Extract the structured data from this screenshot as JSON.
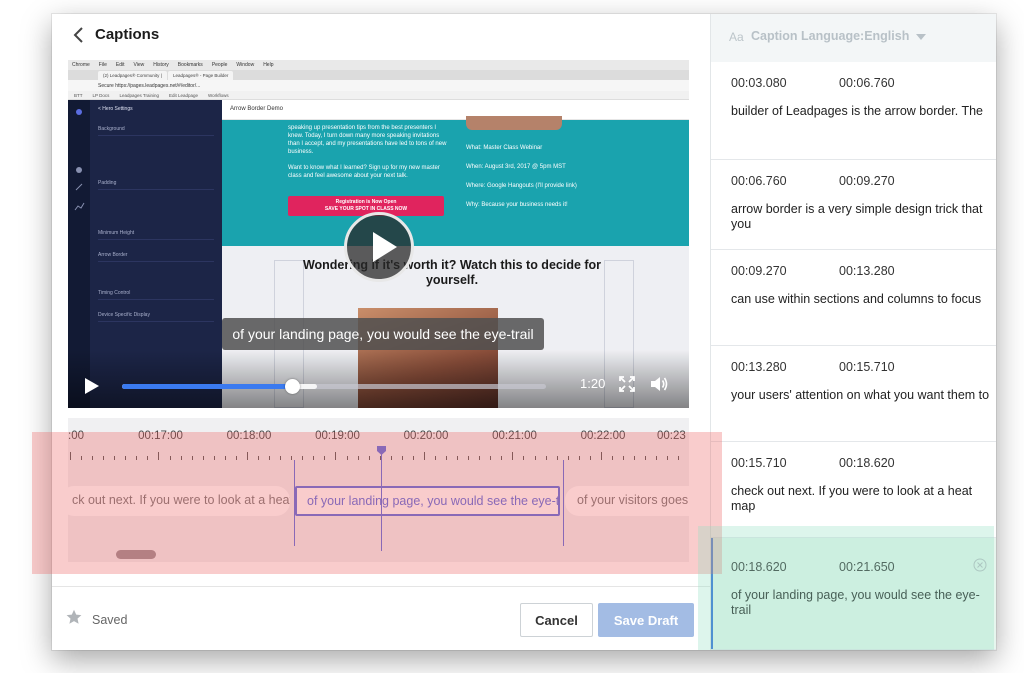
{
  "header": {
    "title": "Captions"
  },
  "video": {
    "browser_menu": [
      "Chrome",
      "File",
      "Edit",
      "View",
      "History",
      "Bookmarks",
      "People",
      "Window",
      "Help"
    ],
    "browser_tabs": [
      "(2) Leadpages® Community |",
      "Leadpages® - Page Builder"
    ],
    "browser_url": "Secure  https://pages.leadpages.net/#/editor/...",
    "bookmarks": [
      "BTT",
      "LP Docs",
      "Leadpages Training",
      "Edit Leadpage",
      "Workflows"
    ],
    "builder": {
      "panel_title": "< Hero Settings",
      "rows": [
        "Background",
        "Padding",
        "Minimum Height",
        "Arrow Border",
        "Timing Control",
        "Device Specific Display"
      ],
      "page_name": "Arrow Border Demo",
      "teal_text": "speaking up presentation tips from the best presenters I knew. Today, I turn down many more speaking invitations than I accept, and my presentations have led to tons of new business.\n\nWant to know what I learned? Sign up for my new master class and feel awesome about your next talk.",
      "details": [
        "What: Master Class Webinar",
        "When: August 3rd, 2017 @ 5pm MST",
        "Where: Google Hangouts (I'll provide link)",
        "Why: Because your business needs it!"
      ],
      "cta": "Registration is Now Open\nSAVE YOUR SPOT IN CLASS NOW",
      "headline": "Wondering if it's worth it? Watch this to decide for yourself."
    },
    "caption_overlay": "of your landing page, you would see the eye-trail",
    "time": "1:20",
    "progress": 0.4,
    "buffered": 0.46
  },
  "timeline": {
    "tick_labels": [
      ":00",
      "00:17:00",
      "00:18:00",
      "00:19:00",
      "00:20:00",
      "00:21:00",
      "00:22:00",
      "00:23"
    ],
    "cues": [
      {
        "text": "ck out next. If you were to look at a heat map",
        "active": false
      },
      {
        "text": "of your landing page, you would see the eye-trail",
        "active": true
      },
      {
        "text": "of your visitors goes",
        "active": false
      }
    ]
  },
  "footer": {
    "saved_label": "Saved",
    "cancel_label": "Cancel",
    "save_draft_label": "Save Draft"
  },
  "sidebar": {
    "language_label": "Caption Language:English",
    "aa_icon": "Aa",
    "captions": [
      {
        "start": "00:03.080",
        "end": "00:06.760",
        "text": "builder of Leadpages is the arrow border. The",
        "active": false
      },
      {
        "start": "00:06.760",
        "end": "00:09.270",
        "text": "arrow border is a very simple design trick that you",
        "active": false
      },
      {
        "start": "00:09.270",
        "end": "00:13.280",
        "text": "can use within sections and columns to focus",
        "active": false
      },
      {
        "start": "00:13.280",
        "end": "00:15.710",
        "text": "your users' attention on what you want them to",
        "active": false
      },
      {
        "start": "00:15.710",
        "end": "00:18.620",
        "text": "check out next. If you were to look at a heat map",
        "active": false
      },
      {
        "start": "00:18.620",
        "end": "00:21.650",
        "text": "of your landing page, you would see the eye-trail",
        "active": true
      }
    ]
  },
  "colors": {
    "accent": "#5b6de0",
    "save_button": "#a3bce4",
    "active_caption_bg": "#e6f6ee"
  }
}
